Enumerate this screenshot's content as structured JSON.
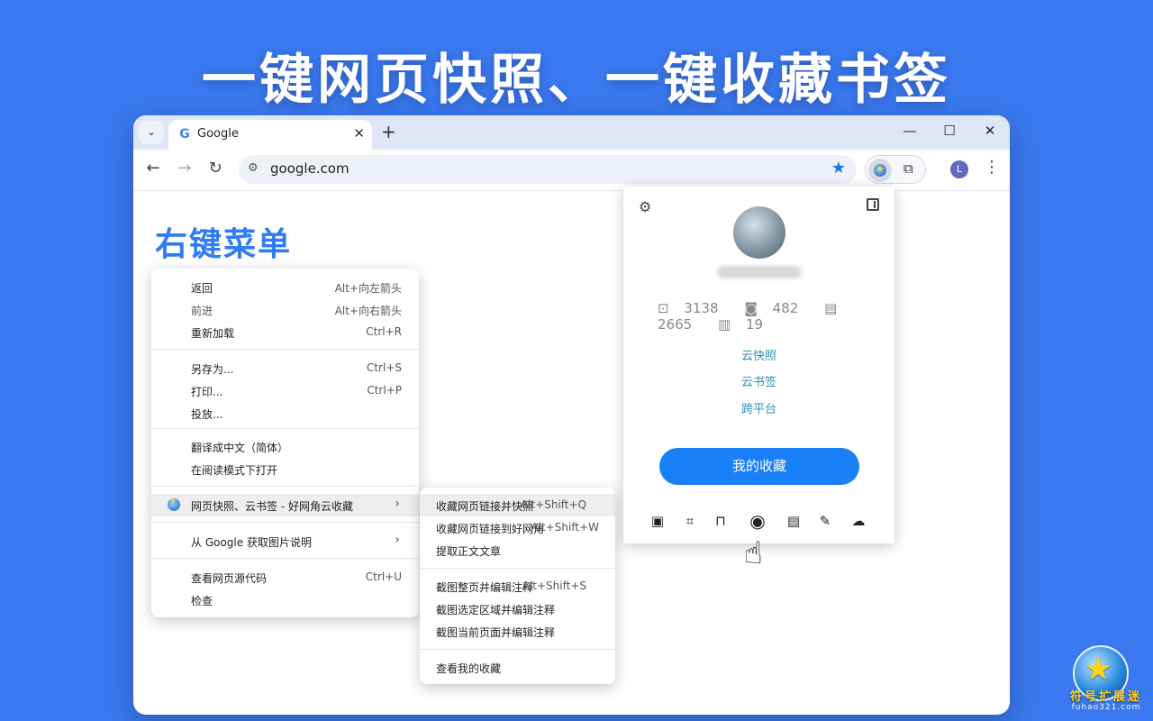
{
  "headline": "一键网页快照、一键收藏书签",
  "browser": {
    "tab_title": "Google",
    "url": "google.com",
    "profile_initial": "L"
  },
  "section_title": "右键菜单",
  "context_menu": {
    "items": [
      {
        "label": "返回",
        "shortcut": "Alt+向左箭头"
      },
      {
        "label": "前进",
        "shortcut": "Alt+向右箭头"
      },
      {
        "label": "重新加载",
        "shortcut": "Ctrl+R"
      },
      {
        "label": "另存为...",
        "shortcut": "Ctrl+S"
      },
      {
        "label": "打印...",
        "shortcut": "Ctrl+P"
      },
      {
        "label": "投放...",
        "shortcut": ""
      },
      {
        "label": "翻译成中文（简体）",
        "shortcut": ""
      },
      {
        "label": "在阅读模式下打开",
        "shortcut": ""
      },
      {
        "label": "网页快照、云书签 - 好网角云收藏",
        "shortcut": ""
      },
      {
        "label": "从 Google 获取图片说明",
        "shortcut": ""
      },
      {
        "label": "查看网页源代码",
        "shortcut": "Ctrl+U"
      },
      {
        "label": "检查",
        "shortcut": ""
      }
    ]
  },
  "submenu": {
    "items": [
      {
        "label": "收藏网页链接并快照",
        "shortcut": "Alt+Shift+Q"
      },
      {
        "label": "收藏网页链接到好网角",
        "shortcut": "Alt+Shift+W"
      },
      {
        "label": "提取正文文章",
        "shortcut": ""
      },
      {
        "label": "截图整页并编辑注释",
        "shortcut": "Alt+Shift+S"
      },
      {
        "label": "截图选定区域并编辑注释",
        "shortcut": ""
      },
      {
        "label": "截图当前页面并编辑注释",
        "shortcut": ""
      },
      {
        "label": "查看我的收藏",
        "shortcut": ""
      }
    ]
  },
  "popup": {
    "stats": {
      "bookmarks": "3138",
      "snapshots": "482",
      "articles": "2665",
      "docs": "19"
    },
    "links": [
      "云快照",
      "云书签",
      "跨平台"
    ],
    "button": "我的收藏",
    "tools": [
      "image-icon",
      "crop-icon",
      "bookmark-icon",
      "camera-icon",
      "document-icon",
      "pencil-icon",
      "cloud-upload-icon"
    ]
  },
  "logo": {
    "text": "符号扩展迷",
    "subtext": "fuhao321.com"
  }
}
